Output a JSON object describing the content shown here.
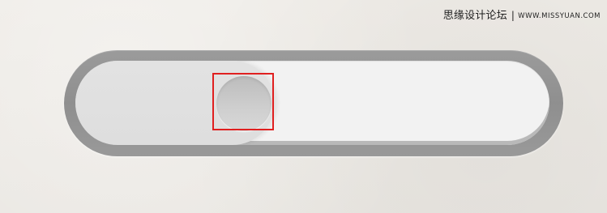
{
  "watermark": {
    "site_name": "思缘设计论坛",
    "separator": "|",
    "url": "WWW.MISSYUAN.COM"
  },
  "toggle": {
    "state": "off",
    "fill_fraction": 0.42,
    "knob_highlighted": true,
    "colors": {
      "outer_border": "#999999",
      "track": "#f2f2f2",
      "fill": "#e0e0e0",
      "knob": "#c8c8c8",
      "highlight": "#e02020"
    }
  }
}
